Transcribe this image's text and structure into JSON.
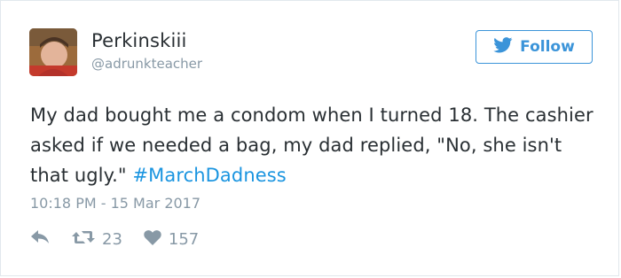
{
  "user": {
    "display_name": "Perkinskiii",
    "handle": "@adrunkteacher"
  },
  "follow_button": {
    "label": "Follow"
  },
  "tweet": {
    "text_parts": [
      "My dad bought me a condom when I turned 18. The cashier asked if we needed a bag, my dad replied, \"No, she isn't that ugly.\" "
    ],
    "hashtag": "#MarchDadness",
    "timestamp": "10:18 PM - 15 Mar 2017"
  },
  "actions": {
    "retweet_count": "23",
    "like_count": "157"
  },
  "icons": {
    "follow": "twitter-bird-icon",
    "reply": "reply-icon",
    "retweet": "retweet-icon",
    "like": "heart-icon"
  },
  "colors": {
    "accent": "#1b95e0",
    "button_blue": "#3b94d9",
    "muted": "#8899a6",
    "text": "#292f33"
  }
}
